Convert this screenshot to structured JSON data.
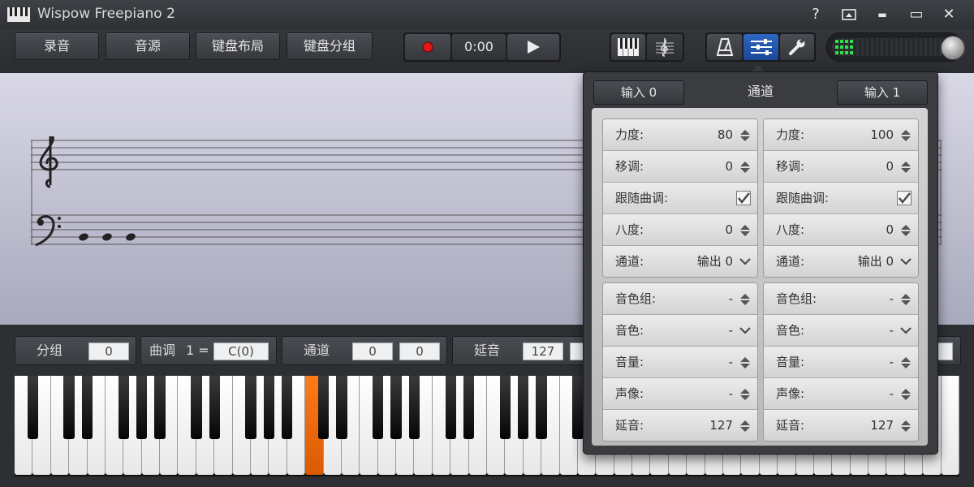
{
  "app": {
    "title": "Wispow Freepiano 2"
  },
  "window_buttons": {
    "help": "?",
    "minimize": "▬",
    "maximize": "▭",
    "close": "✕"
  },
  "toolbar": {
    "record": "录音",
    "sound_source": "音源",
    "keyboard_layout": "键盘布局",
    "keyboard_split": "键盘分组",
    "time": "0:00"
  },
  "icons": {
    "record": "record-dot-icon",
    "play": "play-icon",
    "piano_view": "piano-keys-icon",
    "score_view": "treble-clef-icon",
    "metronome": "metronome-icon",
    "mixer": "sliders-icon",
    "settings": "wrench-icon",
    "volume": "volume-knob-icon"
  },
  "colors": {
    "accent": "#2f66c4",
    "pressed_key": "#ff7a1a",
    "record": "#e01818",
    "meter": "#2fe04a"
  },
  "bottom_bar": {
    "group_label": "分组",
    "group_value": "0",
    "key_label": "曲调",
    "key_prefix": "1 =",
    "key_value": "C(0)",
    "channel_label": "通道",
    "channel_value_1": "0",
    "channel_value_2": "0",
    "sustain_label": "延音",
    "sustain_value": "127"
  },
  "panel": {
    "title": "通道",
    "input_left": "输入 0",
    "input_right": "输入 1",
    "left": {
      "velocity_label": "力度:",
      "velocity_value": "80",
      "transpose_label": "移调:",
      "transpose_value": "0",
      "follow_key_label": "跟随曲调:",
      "follow_key_checked": true,
      "octave_label": "八度:",
      "octave_value": "0",
      "channel_label": "通道:",
      "channel_value": "输出 0",
      "bank_label": "音色组:",
      "bank_value": "-",
      "program_label": "音色:",
      "program_value": "-",
      "volume_label": "音量:",
      "volume_value": "-",
      "pan_label": "声像:",
      "pan_value": "-",
      "sustain_label": "延音:",
      "sustain_value": "127"
    },
    "right": {
      "velocity_label": "力度:",
      "velocity_value": "100",
      "transpose_label": "移调:",
      "transpose_value": "0",
      "follow_key_label": "跟随曲调:",
      "follow_key_checked": true,
      "octave_label": "八度:",
      "octave_value": "0",
      "channel_label": "通道:",
      "channel_value": "输出 0",
      "bank_label": "音色组:",
      "bank_value": "-",
      "program_label": "音色:",
      "program_value": "-",
      "volume_label": "音量:",
      "volume_value": "-",
      "pan_label": "声像:",
      "pan_value": "-",
      "sustain_label": "延音:",
      "sustain_value": "127"
    }
  }
}
